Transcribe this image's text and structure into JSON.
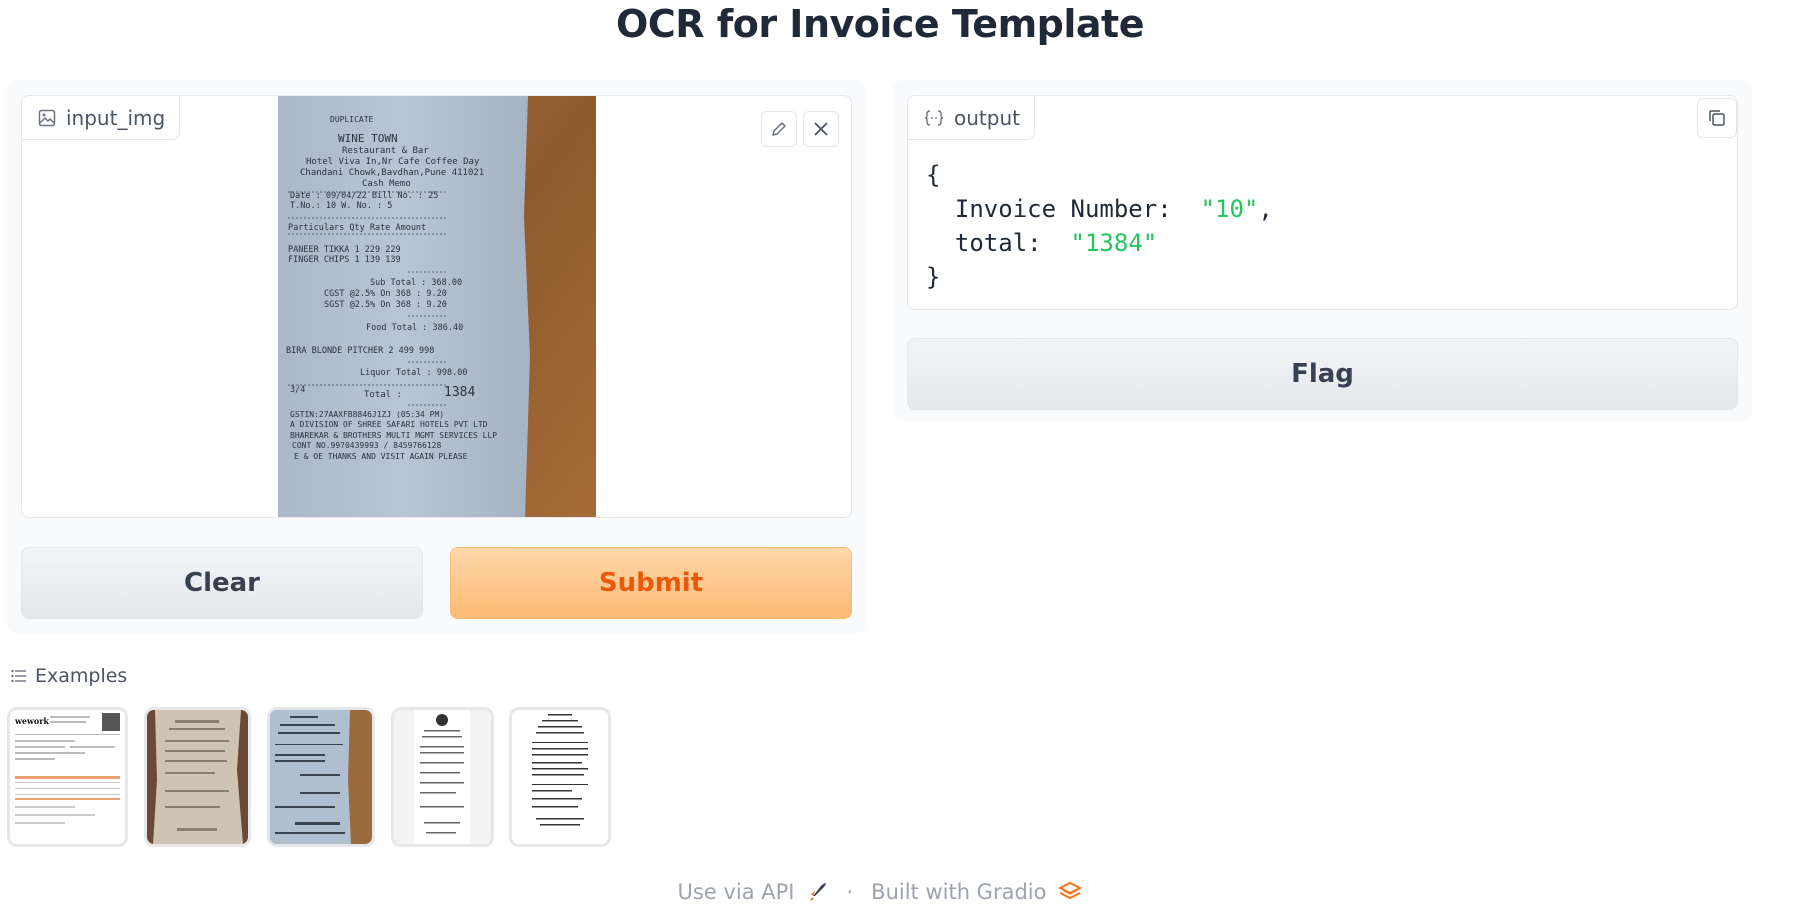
{
  "page": {
    "title": "OCR for Invoice Template"
  },
  "input": {
    "label": "input_img",
    "receipt_lines": [
      "DUPLICATE",
      "WINE  TOWN",
      "Restaurant & Bar",
      "Hotel Viva In,Nr Cafe Coffee Day",
      "Chandani Chowk,Bavdhan,Pune 411021",
      "Cash Memo",
      "Date : 09/04/22     Bill No. : 25",
      "T.No.: 10           W. No.  : 5",
      "Particulars        Qty Rate  Amount",
      "PANEER TIKKA        1   229    229",
      "FINGER CHIPS        1   139    139",
      "Sub Total :   368.00",
      "CGST @2.5% On 368 :    9.20",
      "SGST @2.5% On 368 :    9.20",
      "Food Total :   386.40",
      "BIRA BLONDE PITCHER  2   499   998",
      "Liquor Total :   998.00",
      "3/4",
      "Total :",
      "1384",
      "GSTIN:27AAXFB8846J1ZJ     (05:34 PM)",
      "A DIVISION OF SHREE SAFARI HOTELS PVT LTD",
      "BHAREKAR & BROTHERS MULTI MGMT SERVICES LLP",
      "CONT NO.9970439993 / 8459766128",
      "E & OE THANKS AND VISIT AGAIN PLEASE"
    ]
  },
  "buttons": {
    "clear": "Clear",
    "submit": "Submit",
    "flag": "Flag"
  },
  "output": {
    "label": "output",
    "open_brace": "{",
    "close_brace": "}",
    "fields": [
      {
        "key": "Invoice Number:",
        "value": "\"10\"",
        "trail": ","
      },
      {
        "key": "total:",
        "value": "\"1384\"",
        "trail": ""
      }
    ]
  },
  "examples": {
    "label": "Examples",
    "items": [
      {
        "kind": "wework invoice",
        "logo": "wework"
      },
      {
        "kind": "crumpled receipt"
      },
      {
        "kind": "wine town receipt"
      },
      {
        "kind": "starbucks receipt"
      },
      {
        "kind": "printed receipt"
      }
    ]
  },
  "footer": {
    "api": "Use via API",
    "separator": "·",
    "built": "Built with Gradio"
  },
  "colors": {
    "accent": "#ea580c",
    "json_string": "#22c55e"
  }
}
